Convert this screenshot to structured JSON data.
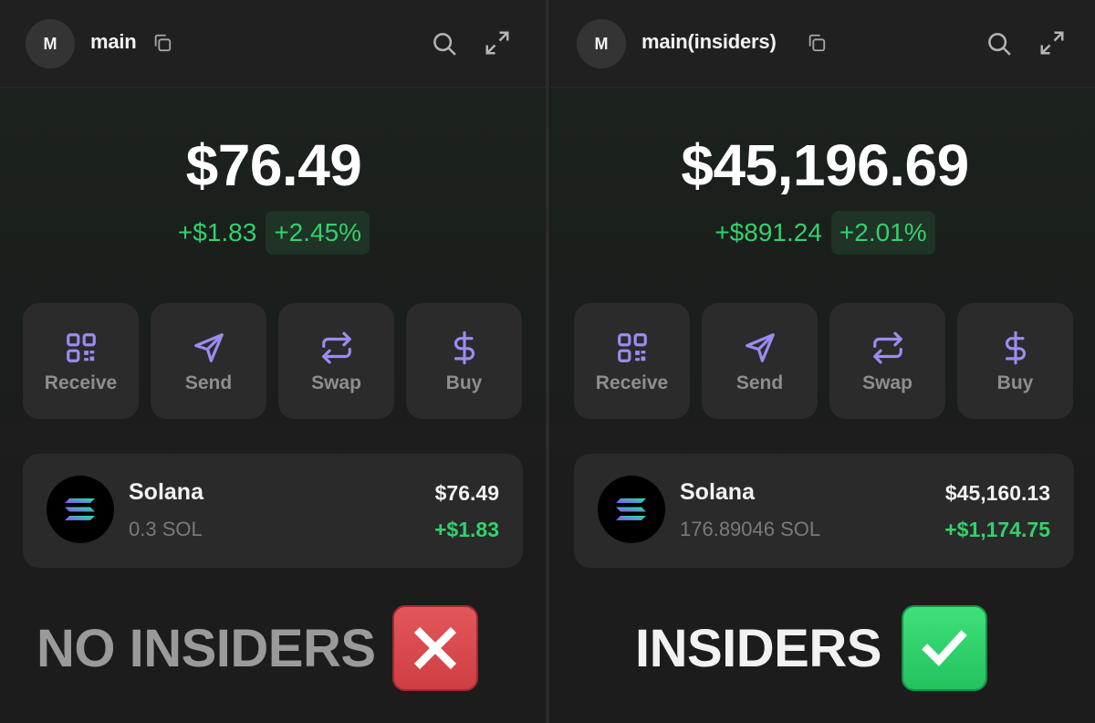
{
  "left": {
    "avatar_letter": "M",
    "wallet_name": "main",
    "balance": "$76.49",
    "change_abs": "+$1.83",
    "change_pct": "+2.45%",
    "actions": [
      {
        "label": "Receive",
        "icon": "qr-code-icon"
      },
      {
        "label": "Send",
        "icon": "send-arrow-icon"
      },
      {
        "label": "Swap",
        "icon": "swap-arrows-icon"
      },
      {
        "label": "Buy",
        "icon": "dollar-icon"
      }
    ],
    "token": {
      "name": "Solana",
      "amount": "0.3 SOL",
      "value": "$76.49",
      "change": "+$1.83"
    },
    "caption": "NO INSIDERS",
    "caption_icon": "red-x-icon"
  },
  "right": {
    "avatar_letter": "M",
    "wallet_name": "main(insiders)",
    "balance": "$45,196.69",
    "change_abs": "+$891.24",
    "change_pct": "+2.01%",
    "actions": [
      {
        "label": "Receive",
        "icon": "qr-code-icon"
      },
      {
        "label": "Send",
        "icon": "send-arrow-icon"
      },
      {
        "label": "Swap",
        "icon": "swap-arrows-icon"
      },
      {
        "label": "Buy",
        "icon": "dollar-icon"
      }
    ],
    "token": {
      "name": "Solana",
      "amount": "176.89046 SOL",
      "value": "$45,160.13",
      "change": "+$1,174.75"
    },
    "caption": "INSIDERS",
    "caption_icon": "green-check-icon"
  },
  "colors": {
    "accent_purple": "#9b8cf2",
    "positive_green": "#33d16c",
    "red_box": "#d9484d",
    "green_box": "#2ad066"
  }
}
